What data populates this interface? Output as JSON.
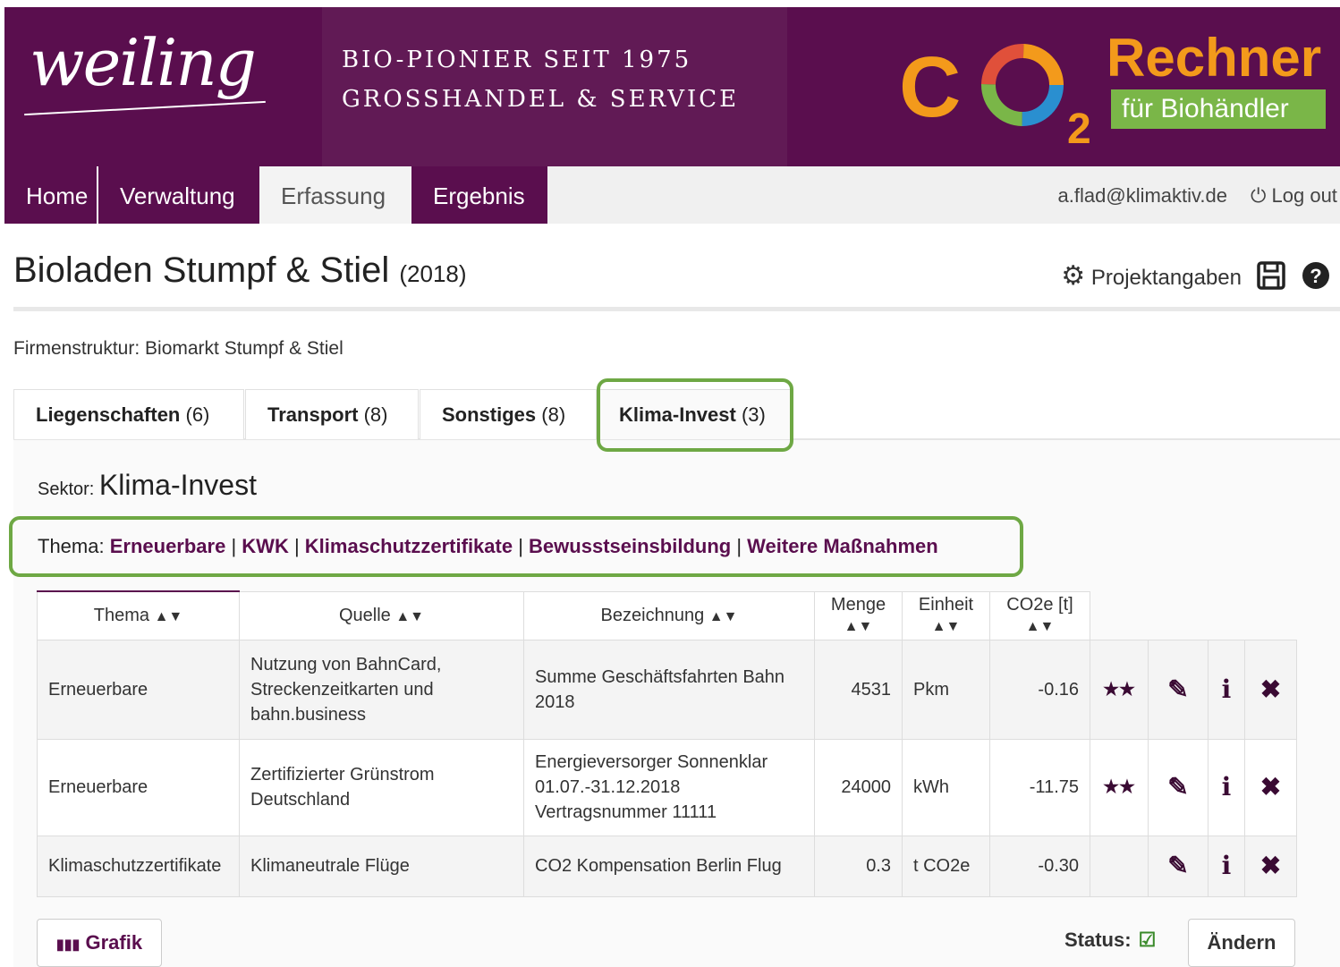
{
  "header": {
    "logo": "weiling",
    "tagline1": "BIO-PIONIER SEIT 1975",
    "tagline2": "GROSSHANDEL & SERVICE",
    "co2": "CO",
    "co2_sub": "2",
    "rechner": "Rechner",
    "biohaendler": "für Biohändler"
  },
  "nav": {
    "items": [
      {
        "label": "Home"
      },
      {
        "label": "Verwaltung"
      },
      {
        "label": "Erfassung"
      },
      {
        "label": "Ergebnis"
      }
    ],
    "active": "Erfassung",
    "user": "a.flad@klimaktiv.de",
    "logout": "Log out"
  },
  "page": {
    "title": "Bioladen Stumpf & Stiel",
    "year": "(2018)",
    "projektangaben": "Projektangaben",
    "firmenstruktur": "Firmenstruktur: Biomarkt Stumpf & Stiel"
  },
  "tabs": [
    {
      "label": "Liegenschaften",
      "count": "(6)"
    },
    {
      "label": "Transport",
      "count": "(8)"
    },
    {
      "label": "Sonstiges",
      "count": "(8)"
    },
    {
      "label": "Klima-Invest",
      "count": "(3)"
    }
  ],
  "sektor": {
    "label": "Sektor:",
    "value": "Klima-Invest"
  },
  "thema": {
    "label": "Thema:",
    "links": [
      "Erneuerbare",
      "KWK",
      "Klimaschutzzertifikate",
      "Bewusstseinsbildung",
      "Weitere Maßnahmen"
    ]
  },
  "table": {
    "headers": [
      "Thema",
      "Quelle",
      "Bezeichnung",
      "Menge",
      "Einheit",
      "CO2e [t]"
    ],
    "rows": [
      {
        "thema": "Erneuerbare",
        "quelle": "Nutzung von BahnCard, Streckenzeitkarten und bahn.business",
        "bezeichnung": "Summe Geschäftsfahrten Bahn 2018",
        "menge": "4531",
        "einheit": "Pkm",
        "co2e": "-0.16",
        "stars": "★★"
      },
      {
        "thema": "Erneuerbare",
        "quelle": "Zertifizierter Grünstrom Deutschland",
        "bezeichnung": "Energieversorger Sonnenklar 01.07.-31.12.2018 Vertragsnummer 11111",
        "menge": "24000",
        "einheit": "kWh",
        "co2e": "-11.75",
        "stars": "★★"
      },
      {
        "thema": "Klimaschutzzertifikate",
        "quelle": "Klimaneutrale Flüge",
        "bezeichnung": "CO2 Kompensation Berlin Flug",
        "menge": "0.3",
        "einheit": "t CO2e",
        "co2e": "-0.30",
        "stars": ""
      }
    ]
  },
  "footer": {
    "grafik": "Grafik",
    "status": "Status:",
    "aendern": "Ändern"
  },
  "colors": {
    "brand": "#5a0e4e",
    "highlight": "#6ea844",
    "accent_orange": "#f39a1b",
    "accent_green": "#7ab648"
  }
}
